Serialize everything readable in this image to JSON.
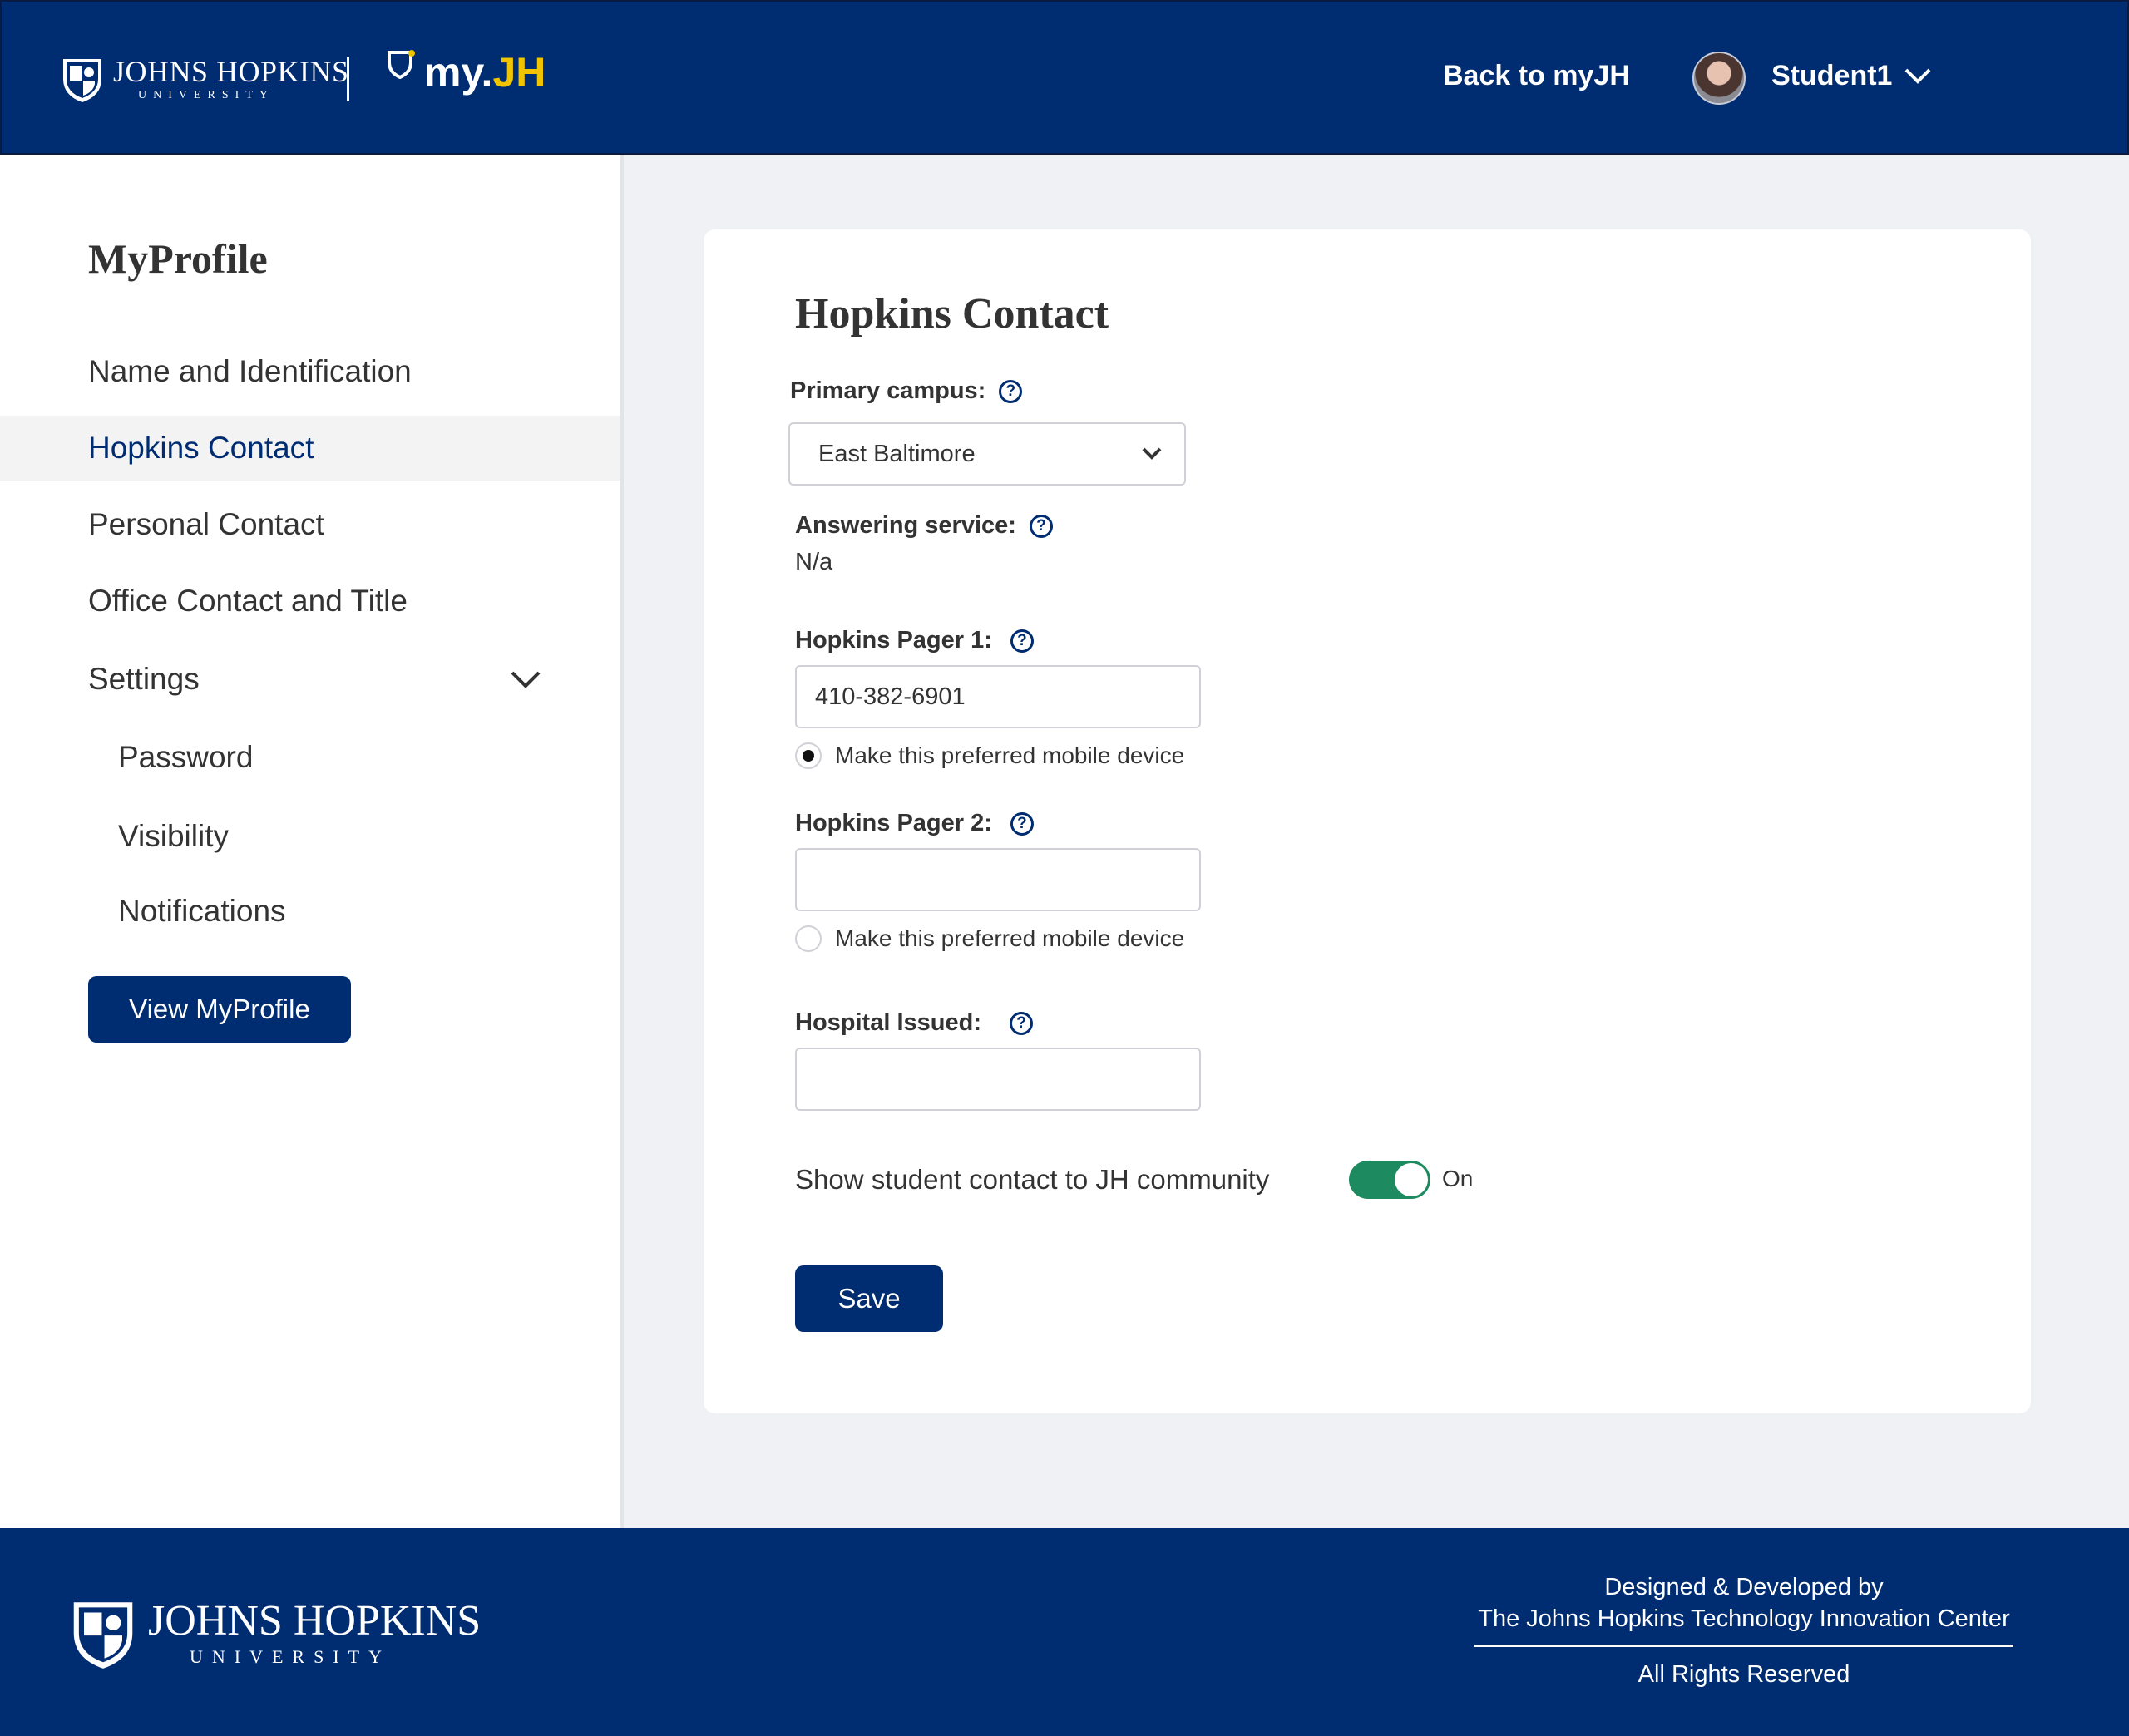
{
  "header": {
    "university_name": "JOHNS HOPKINS",
    "university_sub": "UNIVERSITY",
    "app_name_prefix": "my.",
    "app_name_suffix": "JH",
    "back_link": "Back to myJH",
    "user_name": "Student1",
    "brand_color": "#002d72",
    "accent_color": "#f1c400"
  },
  "sidebar": {
    "title": "MyProfile",
    "items": [
      {
        "label": "Name and Identification"
      },
      {
        "label": "Hopkins Contact",
        "active": true
      },
      {
        "label": "Personal Contact"
      },
      {
        "label": "Office Contact and Title"
      },
      {
        "label": "Settings",
        "expanded": true
      }
    ],
    "settings_items": [
      {
        "label": "Password"
      },
      {
        "label": "Visibility"
      },
      {
        "label": "Notifications"
      }
    ],
    "view_button": "View MyProfile"
  },
  "form": {
    "title": "Hopkins Contact",
    "primary_campus_label": "Primary campus:",
    "primary_campus_value": "East Baltimore",
    "answering_service_label": "Answering service:",
    "answering_service_value": "N/a",
    "pager1_label": "Hopkins Pager 1:",
    "pager1_value": "410-382-6901",
    "pager1_preferred_label": "Make this preferred mobile device",
    "pager1_preferred": true,
    "pager2_label": "Hopkins Pager 2:",
    "pager2_value": "",
    "pager2_preferred_label": "Make this preferred mobile device",
    "pager2_preferred": false,
    "hospital_label": "Hospital Issued:",
    "hospital_value": "",
    "show_contact_label": "Show student contact to JH community",
    "show_contact_state": "On",
    "toggle_color": "#1e8a60",
    "save_label": "Save",
    "help_glyph": "?"
  },
  "footer": {
    "university_name": "JOHNS HOPKINS",
    "university_sub": "UNIVERSITY",
    "credit_line1": "Designed & Developed by",
    "credit_line2": "The Johns Hopkins Technology Innovation Center",
    "rights": "All Rights Reserved"
  }
}
